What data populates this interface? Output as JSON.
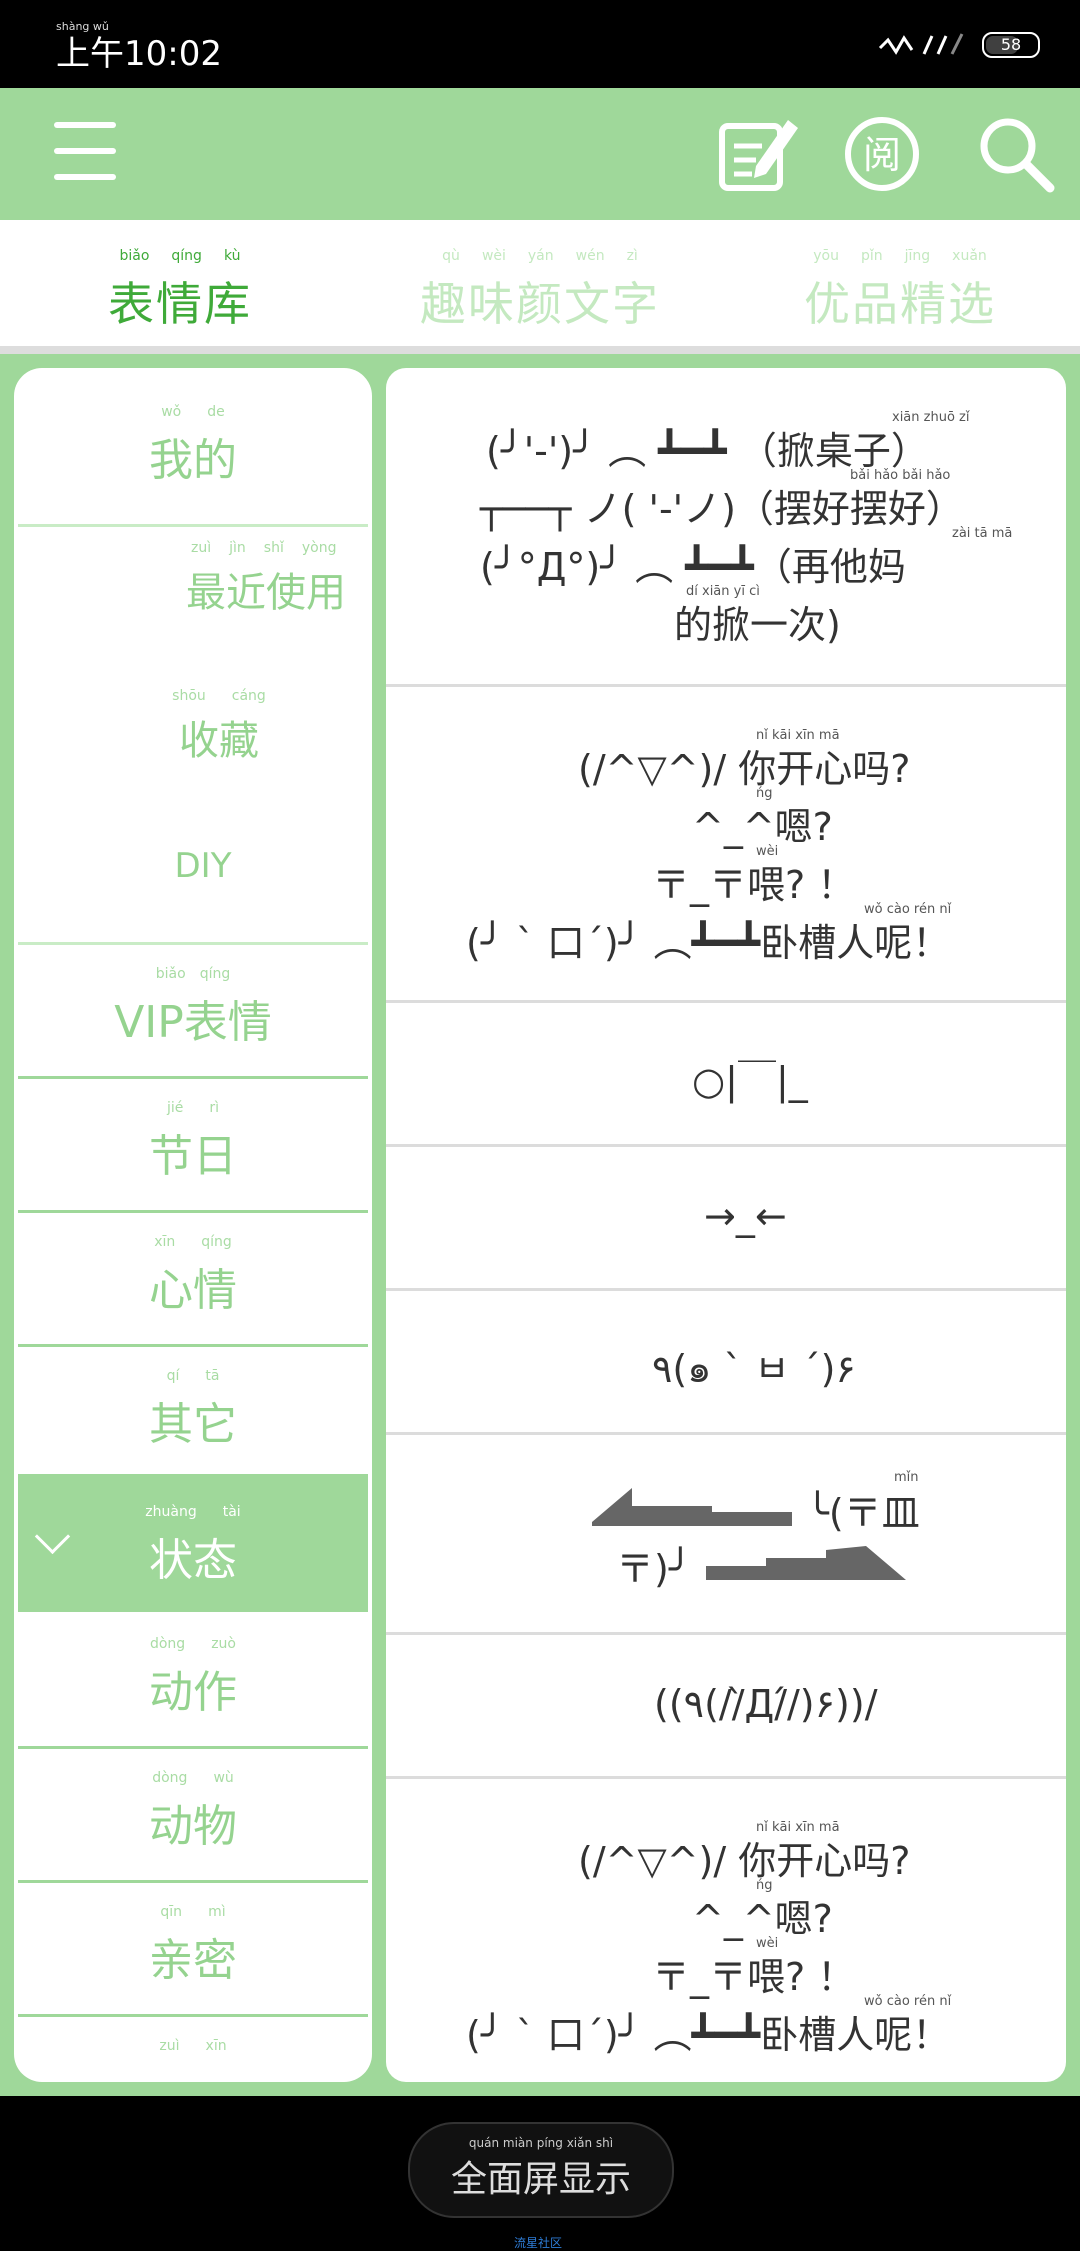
{
  "status_bar": {
    "time_prefix": "上午",
    "time": "10:02",
    "pinyin": "shàng wǔ",
    "battery": "58"
  },
  "toolbar": {
    "icons": [
      "menu-icon",
      "edit-icon",
      "read-icon",
      "search-icon"
    ]
  },
  "tabs": [
    {
      "label": "表情库",
      "pinyin": [
        "biǎo",
        "qíng",
        "kù"
      ],
      "active": true
    },
    {
      "label": "趣味颜文字",
      "pinyin": [
        "qù",
        "wèi",
        "yán",
        "wén",
        "zì"
      ],
      "active": false
    },
    {
      "label": "优品精选",
      "pinyin": [
        "yōu",
        "pǐn",
        "jīng",
        "xuǎn"
      ],
      "active": false
    }
  ],
  "sidebar": {
    "items": [
      {
        "label": "我的",
        "pinyin": [
          "wǒ",
          "de"
        ]
      },
      {
        "label": "最近使用",
        "pinyin": [
          "zuì",
          "jìn",
          "shǐ",
          "yòng"
        ]
      },
      {
        "label": "收藏",
        "pinyin": [
          "shōu",
          "cáng"
        ]
      },
      {
        "label": "DIY",
        "pinyin": []
      },
      {
        "label": "VIP表情",
        "pinyin": [
          "biǎo",
          "qíng"
        ]
      },
      {
        "label": "节日",
        "pinyin": [
          "jié",
          "rì"
        ]
      },
      {
        "label": "心情",
        "pinyin": [
          "xīn",
          "qíng"
        ]
      },
      {
        "label": "其它",
        "pinyin": [
          "qí",
          "tā"
        ]
      },
      {
        "label": "状态",
        "pinyin": [
          "zhuàng",
          "tài"
        ],
        "active": true
      },
      {
        "label": "动作",
        "pinyin": [
          "dòng",
          "zuò"
        ]
      },
      {
        "label": "动物",
        "pinyin": [
          "dòng",
          "wù"
        ]
      },
      {
        "label": "亲密",
        "pinyin": [
          "qīn",
          "mì"
        ]
      },
      {
        "label": "",
        "pinyin": [
          "zuì",
          "xīn"
        ]
      }
    ]
  },
  "emoticons": {
    "c1": {
      "py1": "xiān zhuō zǐ",
      "l1": "(╯'-')╯ ︵ ┻━┻ （掀桌子）",
      "py2": "bǎi hǎo bǎi hǎo",
      "l2": "┬──┬ ノ( '-'ノ)（摆好摆好）",
      "py3": "zài tā mā",
      "l3": "(╯°Д°)╯ ︵ ┻━┻（再他妈",
      "py4": "dí xiān yī cì",
      "l4": "的掀一次)"
    },
    "c2": {
      "py1": "nǐ kāi xīn mā",
      "l1": "(/^▽^)/   你开心吗?",
      "py2": "ńg",
      "l2": "^_^嗯?",
      "py3": "wèi",
      "l3": "〒_〒喂? ！",
      "py4": "wǒ cào rén nǐ",
      "l4": "(╯ ` 口´)╯ ︵┻━┻卧槽人呢！"
    },
    "c3": {
      "l1": "○|￣|_"
    },
    "c4": {
      "l1": "→_←"
    },
    "c5": {
      "l1": "٩(๑ ` ㅂ ´)۶"
    },
    "c6": {
      "py1": "mǐn",
      "l1": "╰(〒皿",
      "l2": "〒)╯"
    },
    "c7": {
      "l1": "((٩(//̀Д/́/)۶))/"
    },
    "c8": {
      "py1": "nǐ kāi xīn mā",
      "l1": "(/^▽^)/   你开心吗?",
      "py2": "ńg",
      "l2": "^_^嗯?",
      "py3": "wèi",
      "l3": "〒_〒喂? ！",
      "py4": "wǒ cào rén nǐ",
      "l4": "(╯ ` 口´)╯ ︵┻━┻卧槽人呢！"
    }
  },
  "bottom": {
    "fullscreen_label": "全面屏显示",
    "fullscreen_pinyin": "quán miàn píng xiǎn shì",
    "footer_link": "流星社区"
  }
}
